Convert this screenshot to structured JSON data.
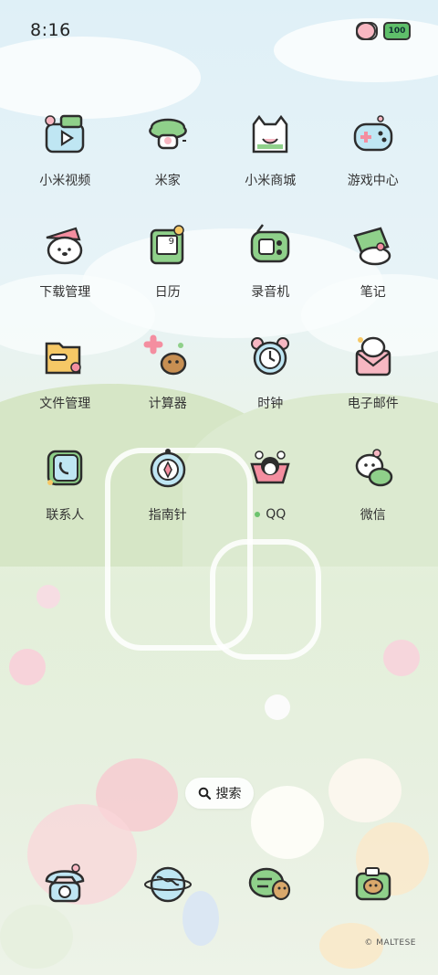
{
  "status_bar": {
    "time": "8:16",
    "battery": "100"
  },
  "apps": [
    {
      "label": "小米视频",
      "icon": "video-icon"
    },
    {
      "label": "米家",
      "icon": "mijia-icon"
    },
    {
      "label": "小米商城",
      "icon": "shop-bag-icon"
    },
    {
      "label": "游戏中心",
      "icon": "gamepad-icon"
    },
    {
      "label": "下载管理",
      "icon": "download-dog-icon"
    },
    {
      "label": "日历",
      "icon": "calendar-icon",
      "badge": "9"
    },
    {
      "label": "录音机",
      "icon": "recorder-icon"
    },
    {
      "label": "笔记",
      "icon": "notes-icon"
    },
    {
      "label": "文件管理",
      "icon": "folder-icon"
    },
    {
      "label": "计算器",
      "icon": "calculator-icon"
    },
    {
      "label": "时钟",
      "icon": "alarm-clock-icon"
    },
    {
      "label": "电子邮件",
      "icon": "email-icon"
    },
    {
      "label": "联系人",
      "icon": "contacts-icon"
    },
    {
      "label": "指南针",
      "icon": "compass-icon"
    },
    {
      "label": "QQ",
      "icon": "qq-penguin-icon",
      "new_indicator": true
    },
    {
      "label": "微信",
      "icon": "wechat-icon"
    }
  ],
  "search": {
    "label": "搜索"
  },
  "dock": [
    {
      "icon": "phone-icon"
    },
    {
      "icon": "browser-globe-icon"
    },
    {
      "icon": "messages-icon"
    },
    {
      "icon": "camera-icon"
    }
  ],
  "watermark": "© MALTESE",
  "colors": {
    "accent_green": "#6cc36e",
    "pink": "#f7b7c2",
    "sky": "#dff0f7"
  }
}
